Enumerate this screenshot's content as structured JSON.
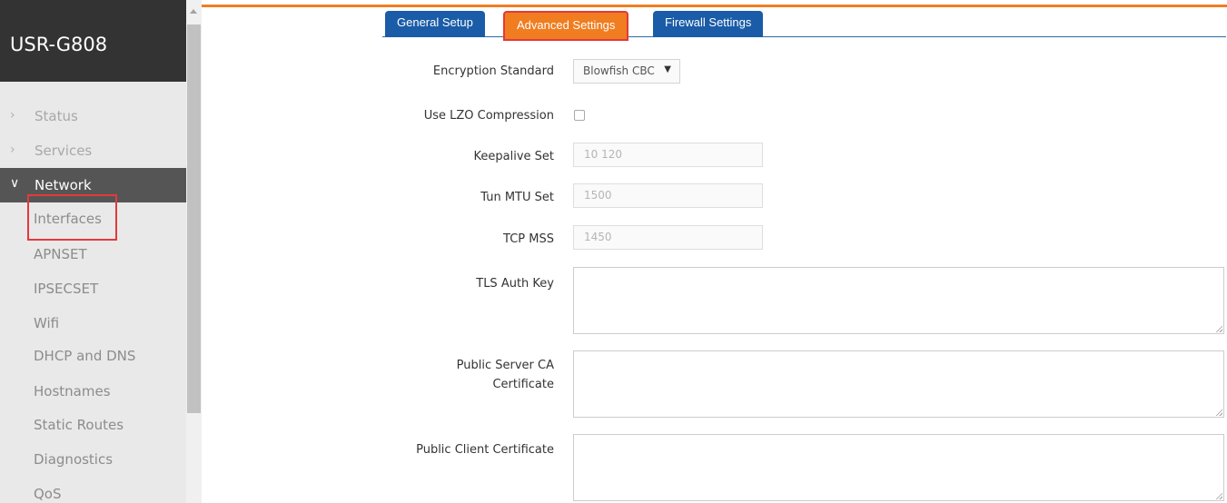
{
  "brand": "USR-G808",
  "nav": {
    "status": "Status",
    "services": "Services",
    "network": "Network",
    "sub_items": [
      "Interfaces",
      "APNSET",
      "IPSECSET",
      "Wifi",
      "DHCP and DNS",
      "Hostnames",
      "Static Routes",
      "Diagnostics",
      "QoS"
    ]
  },
  "tabs": [
    "General Setup",
    "Advanced Settings",
    "Firewall Settings"
  ],
  "form": {
    "encryption_label": "Encryption Standard",
    "encryption_value": "Blowfish CBC",
    "lzo_label": "Use LZO Compression",
    "keepalive_label": "Keepalive Set",
    "keepalive_placeholder": "10 120",
    "mtu_label": "Tun MTU Set",
    "mtu_placeholder": "1500",
    "mss_label": "TCP MSS",
    "mss_placeholder": "1450",
    "tls_label": "TLS Auth Key",
    "server_ca_label_line1": "Public Server CA",
    "server_ca_label_line2": "Certificate",
    "client_cert_label": "Public Client Certificate"
  },
  "colors": {
    "accent_orange": "#f07d20",
    "tab_blue": "#1a5ca7",
    "highlight_red": "#e4393c",
    "sidebar_dark": "#333333"
  },
  "icons": {
    "collapsed": "chevron-right-icon",
    "expanded": "chevron-down-icon",
    "select_caret": "caret-down-icon"
  }
}
